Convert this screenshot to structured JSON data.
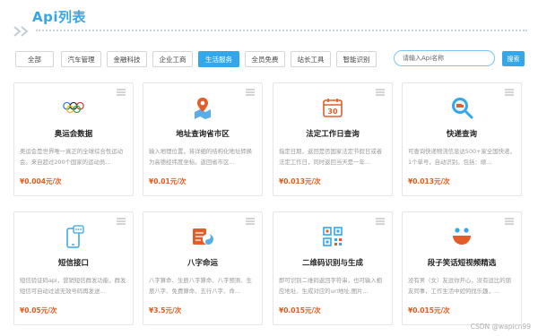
{
  "page": {
    "title": "Api列表",
    "accent_color": "#35a7e8",
    "price_color": "#e25a1c"
  },
  "filters": {
    "tabs": [
      {
        "label": "全部"
      },
      {
        "label": "汽车管理"
      },
      {
        "label": "金融科技"
      },
      {
        "label": "企业工商"
      },
      {
        "label": "生活服务",
        "active": true
      },
      {
        "label": "全员免费"
      },
      {
        "label": "站长工具"
      },
      {
        "label": "智能识别"
      }
    ]
  },
  "search": {
    "placeholder": "请输入Api名称",
    "button_label": "搜索"
  },
  "cards": [
    {
      "icon": "olympic-rings-icon",
      "title": "奥运会数据",
      "desc": "奥运会是世界唯一真正的全球综合性运动会。来自超过200个国家的运动员…",
      "price": "¥0.004元/次"
    },
    {
      "icon": "map-pin-icon",
      "title": "地址查询省市区",
      "desc": "输入地理位置，将详细的结构化地址转换为高德经纬度坐标。返回省市区…",
      "price": "¥0.01元/次"
    },
    {
      "icon": "calendar-icon",
      "title": "法定工作日查询",
      "desc": "指定日期，返回是否国家法定节假日或者法定工作日，同时返回当天是一年…",
      "price": "¥0.013元/次"
    },
    {
      "icon": "express-search-icon",
      "title": "快递查询",
      "desc": "可查询快递物流信息达500+家全国快递，1个单号，自动识别。包括：顺…",
      "price": "¥0.013元/次"
    },
    {
      "icon": "sms-phone-icon",
      "title": "短信接口",
      "desc": "短信验证码api，营销短信群发功能，群发短信可自动过滤无效号码再发送…",
      "price": "¥0.05元/次"
    },
    {
      "icon": "bazi-icon",
      "title": "八字命运",
      "desc": "八字算命、生辰八字算命、八字预测、生辰八字、免费算命、五行八字、命…",
      "price": "¥3.5元/次"
    },
    {
      "icon": "qrcode-icon",
      "title": "二维码识别与生成",
      "desc": "即可识别二维码返回字符串，也可输入相应地址、生成对应的url地址,图片…",
      "price": "¥0.015元/次"
    },
    {
      "icon": "funny-face-icon",
      "title": "段子笑话短视频精选",
      "desc": "没有男（女）友逗你开心，没有逗比的朋友同事，工作生活中如何找乐趣，…",
      "price": "¥0.015元/次"
    }
  ],
  "watermark": "CSDN @wapicn99"
}
